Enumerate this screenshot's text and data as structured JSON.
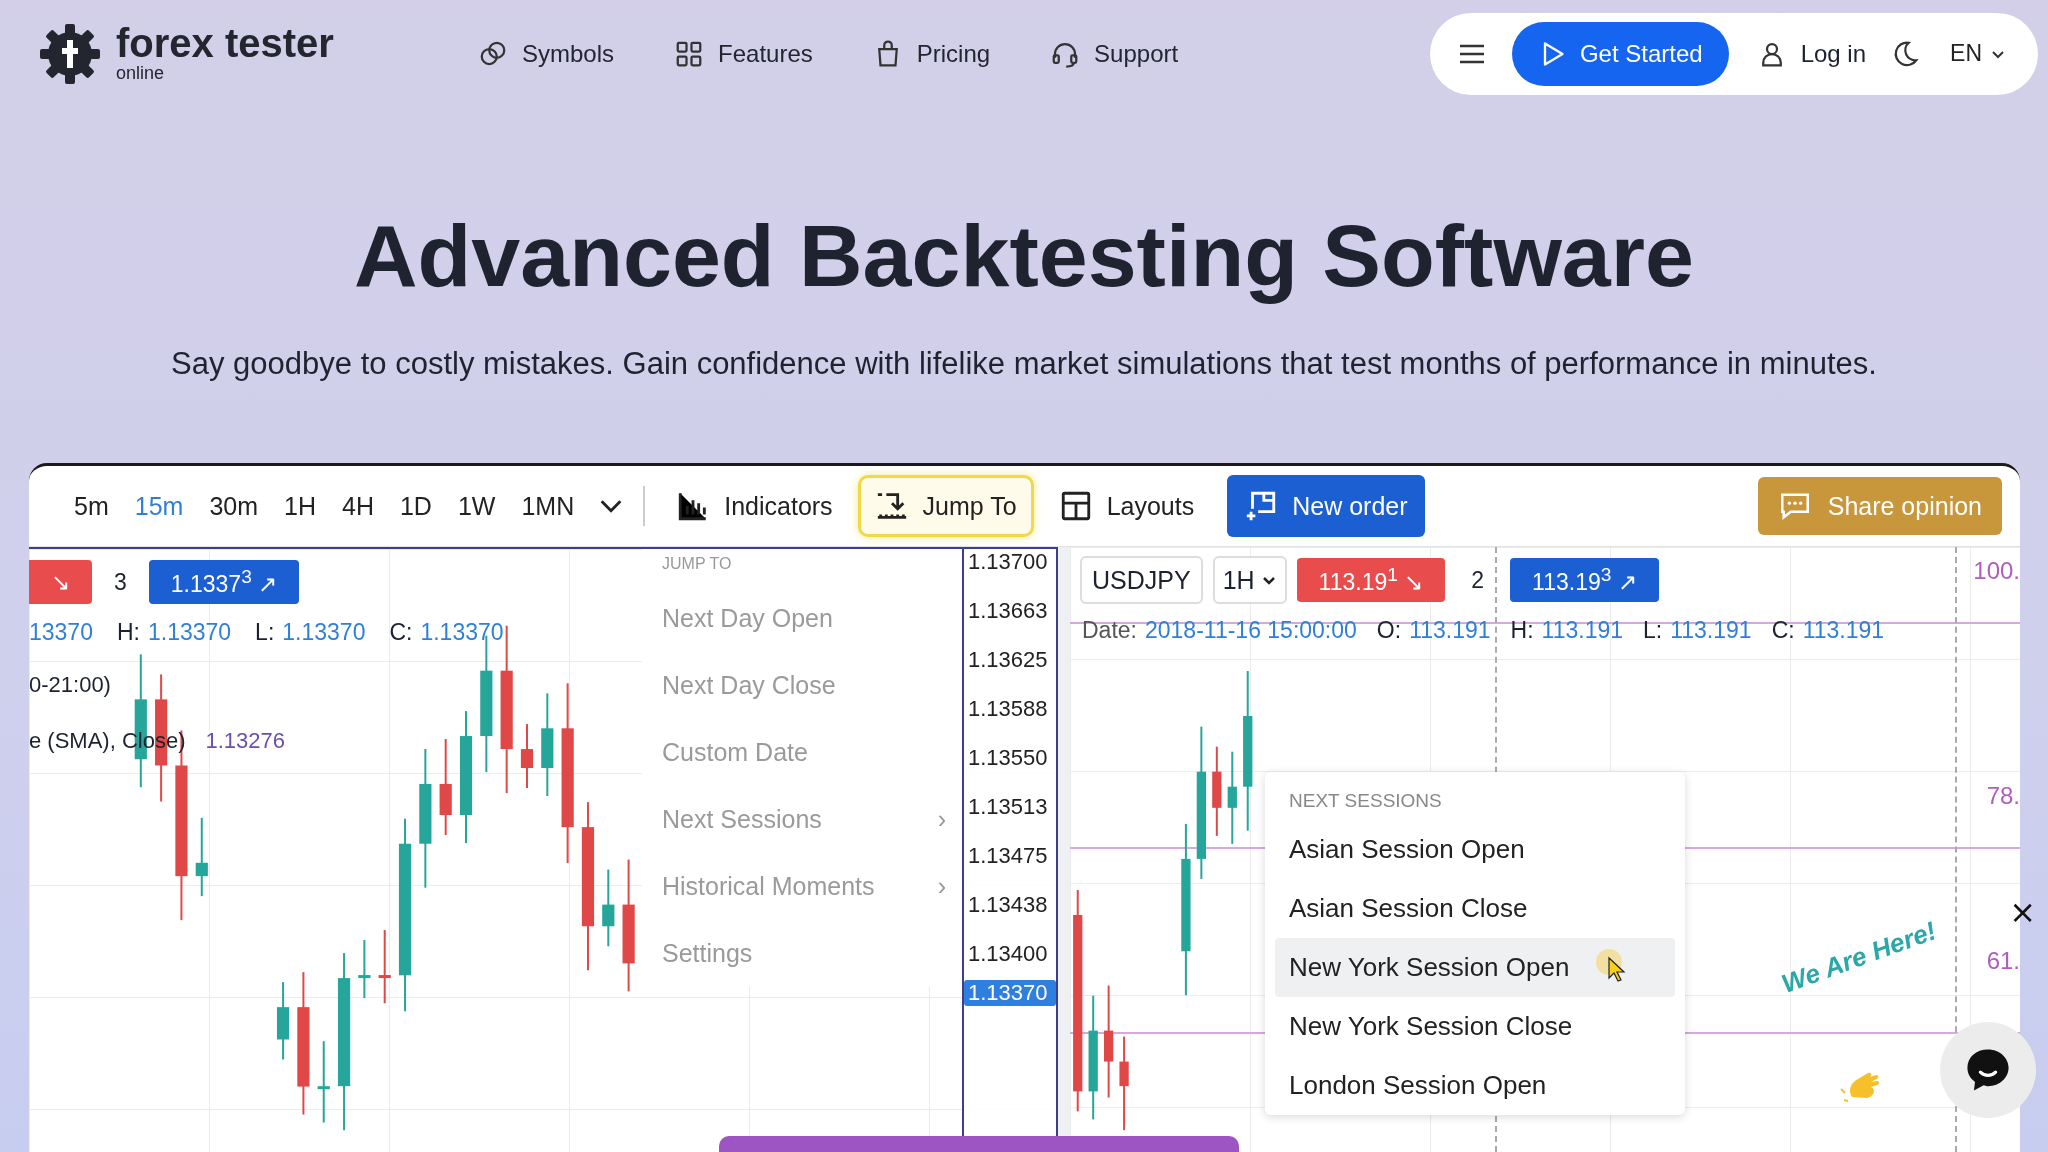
{
  "nav": {
    "logo": {
      "name": "forex tester",
      "tagline": "online"
    },
    "links": [
      {
        "label": "Symbols"
      },
      {
        "label": "Features"
      },
      {
        "label": "Pricing"
      },
      {
        "label": "Support"
      }
    ],
    "cta": "Get Started",
    "login": "Log in",
    "language": "EN"
  },
  "hero": {
    "title": "Advanced Backtesting Software",
    "subtitle": "Say goodbye to costly mistakes. Gain confidence with lifelike market simulations that test months of performance in minutes."
  },
  "app": {
    "timeframes": [
      {
        "label": "5m",
        "selected": false
      },
      {
        "label": "15m",
        "selected": true
      },
      {
        "label": "30m",
        "selected": false
      },
      {
        "label": "1H",
        "selected": false
      },
      {
        "label": "4H",
        "selected": false
      },
      {
        "label": "1D",
        "selected": false
      },
      {
        "label": "1W",
        "selected": false
      },
      {
        "label": "1MN",
        "selected": false
      }
    ],
    "tools": [
      {
        "kind": "plain",
        "label": "Indicators"
      },
      {
        "kind": "highlighted",
        "label": "Jump To"
      },
      {
        "kind": "plain",
        "label": "Layouts"
      },
      {
        "kind": "primary",
        "label": "New order"
      }
    ],
    "share": "Share opinion",
    "left_chart": {
      "sell": "↘",
      "count": "3",
      "buy": "1.1337$^{3}$ ↗",
      "ohlc": [
        {
          "value": "13370"
        },
        {
          "label": "H:",
          "value": "1.13370"
        },
        {
          "label": "L:",
          "value": "1.13370"
        },
        {
          "label": "C:",
          "value": "1.13370"
        }
      ],
      "session": "0-21:00)",
      "study": {
        "label": "e (SMA), Close)",
        "value": "1.13276"
      },
      "price_axis": [
        "1.13700",
        "1.13663",
        "1.13625",
        "1.13588",
        "1.13550",
        "1.13513",
        "1.13475",
        "1.13438",
        "1.13400"
      ],
      "current_price": "1.13370"
    },
    "jump_menu": {
      "heading": "JUMP TO",
      "items": [
        {
          "label": "Next Day Open"
        },
        {
          "label": "Next Day Close"
        },
        {
          "label": "Custom Date"
        },
        {
          "label": "Next Sessions",
          "arrow": "›"
        },
        {
          "label": "Historical Moments",
          "arrow": "›"
        },
        {
          "label": "Settings"
        }
      ]
    },
    "right_chart": {
      "symbol": "USDJPY",
      "timeframe": "1H",
      "sell": "113.19$^{1}$ ↘",
      "count": "2",
      "buy": "113.19$^{3}$ ↗",
      "date_label": "Date:",
      "date": "2018-11-16 15:00:00",
      "ohlc": [
        {
          "label": "O:",
          "value": "113.191"
        },
        {
          "label": "H:",
          "value": "113.191"
        },
        {
          "label": "L:",
          "value": "113.191"
        },
        {
          "label": "C:",
          "value": "113.191"
        }
      ],
      "levels": [
        "100.",
        "78.",
        "61."
      ]
    },
    "sessions_menu": {
      "heading": "NEXT SESSIONS",
      "items": [
        {
          "label": "Asian Session Open",
          "selected": false
        },
        {
          "label": "Asian Session Close",
          "selected": false
        },
        {
          "label": "New York Session Open",
          "selected": true
        },
        {
          "label": "New York Session Close",
          "selected": false
        },
        {
          "label": "London Session Open",
          "selected": false
        }
      ]
    }
  },
  "chat": {
    "tagline": "We Are Here!",
    "close": "×"
  }
}
